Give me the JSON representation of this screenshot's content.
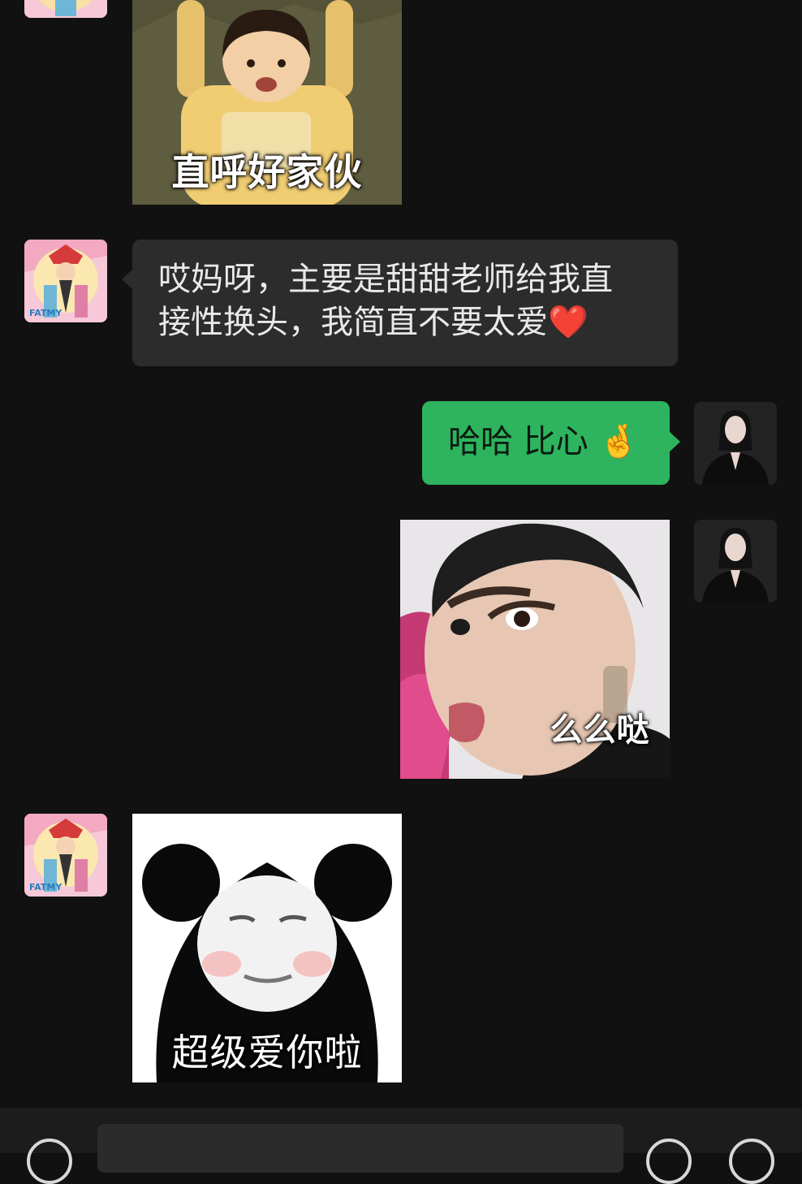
{
  "messages": [
    {
      "side": "left",
      "type": "sticker",
      "caption": "直呼好家伙"
    },
    {
      "side": "left",
      "type": "text",
      "line1": "哎妈呀，主要是甜甜老师给我直",
      "line2": "接性换头，我简直不要太爱",
      "emoji": "❤️"
    },
    {
      "side": "right",
      "type": "text",
      "text": "哈哈 比心",
      "emoji": "🤞"
    },
    {
      "side": "right",
      "type": "sticker",
      "caption": "么么哒"
    },
    {
      "side": "left",
      "type": "sticker",
      "caption": "超级爱你啦"
    }
  ],
  "icons": {
    "voice": "voice-toggle-icon",
    "emoji": "emoji-icon",
    "more": "plus-icon"
  },
  "colors": {
    "background": "#111111",
    "bubble_incoming": "#2c2c2c",
    "bubble_outgoing": "#2eb45e"
  }
}
